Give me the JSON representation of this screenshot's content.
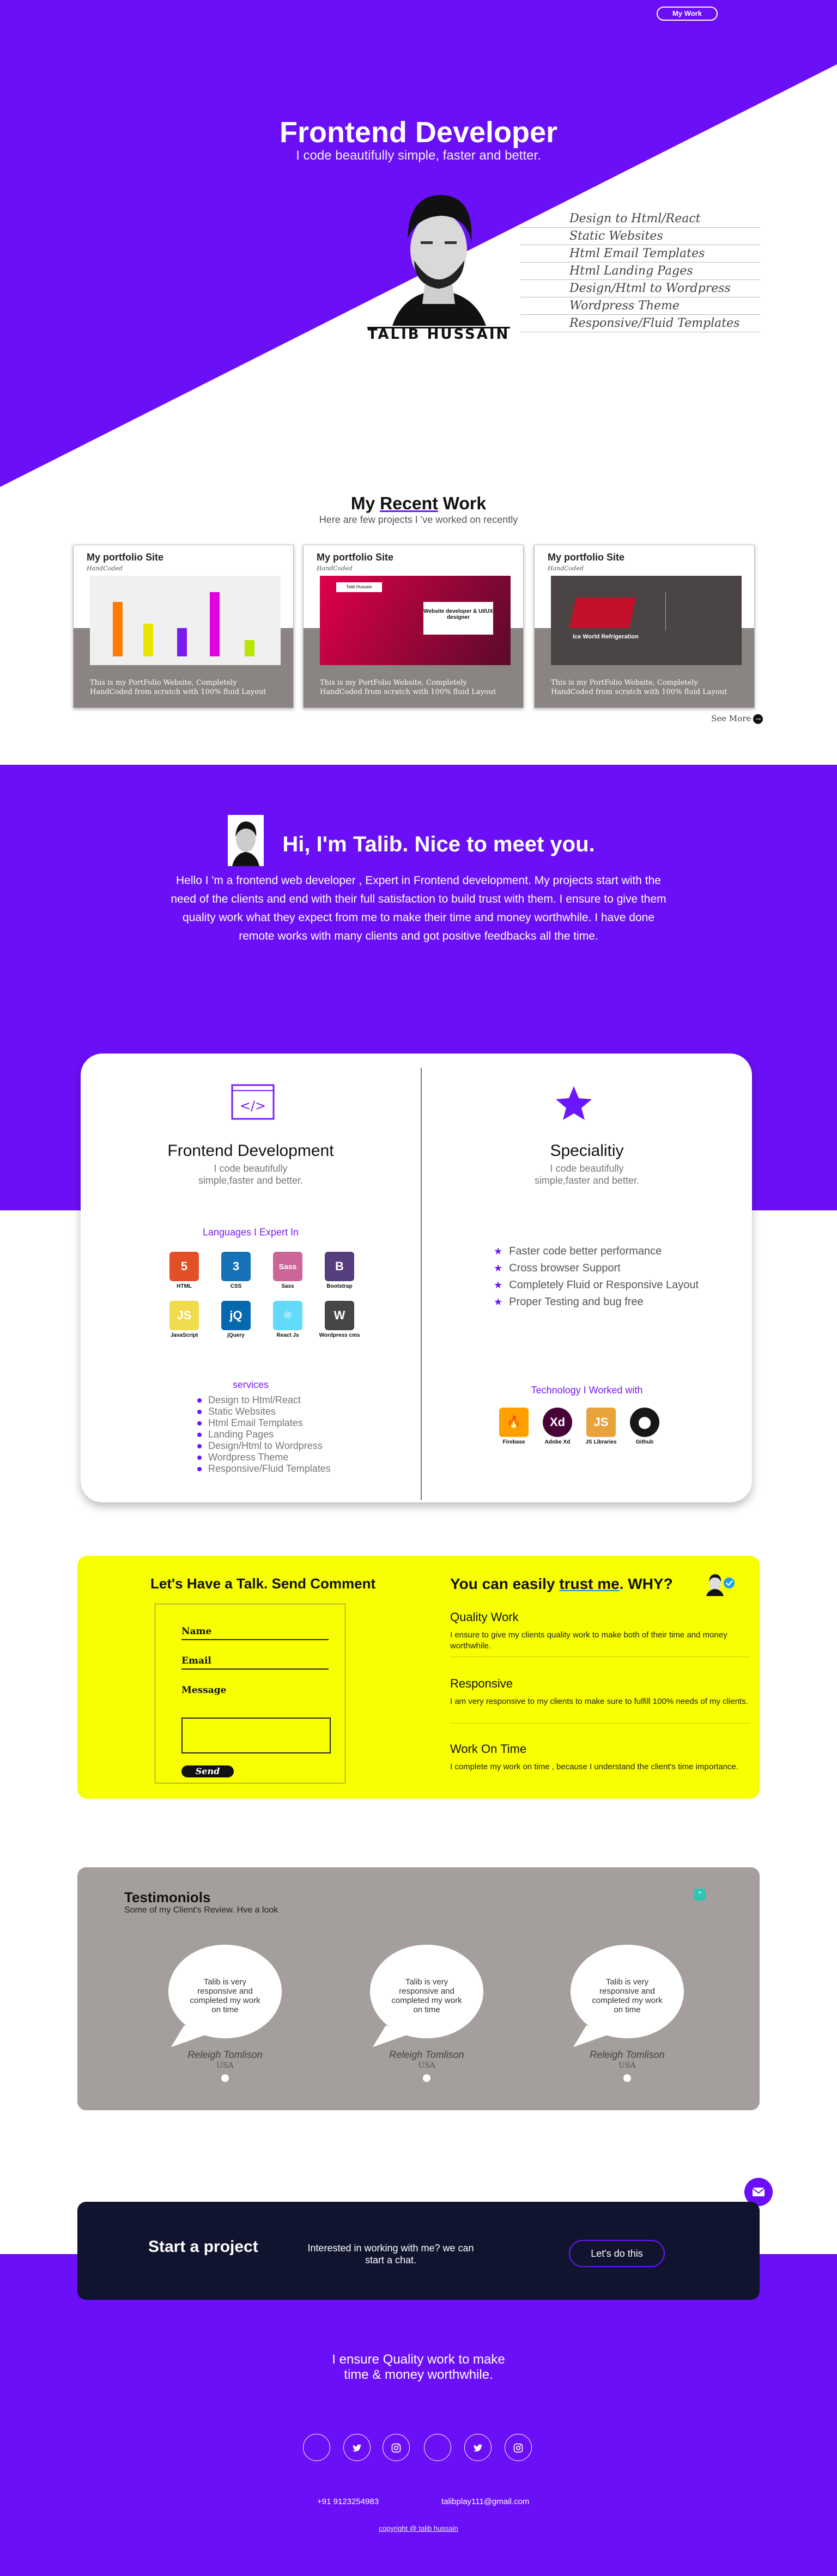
{
  "nav": {
    "my_work": "My Work"
  },
  "hero": {
    "title": "Frontend Developer",
    "subtitle": "I code beautifully simple, faster and better.",
    "name_caption": "TALIB HUSSAIN",
    "skills": [
      "Design to Html/React",
      "Static Websites",
      "Html Email Templates",
      "Html Landing Pages",
      "Design/Html to Wordpress",
      "Wordpress Theme",
      "Responsive/Fluid Templates"
    ]
  },
  "recent": {
    "title_pre": "My ",
    "title_u": "Recent",
    "title_post": " Work",
    "subtitle": "Here are few projects I 've worked on recently",
    "cards": [
      {
        "title": "My portfolio Site",
        "subtitle": "HandCoded",
        "desc": "This is my PortFolio Website, Completely HandCoded from scratch with 100% fluid Layout"
      },
      {
        "title": "My portfolio Site",
        "subtitle": "HandCoded",
        "desc": "This is my PortFolio Website, Completely HandCoded from scratch with 100% fluid Layout",
        "shot_text_a": "Talib Hussain",
        "shot_text_b": "Website developer & UI/UX designer"
      },
      {
        "title": "My portfolio Site",
        "subtitle": "HandCoded",
        "desc": "This is my PortFolio Website, Completely HandCoded from scratch with 100% fluid Layout",
        "shot_text_a": "Ice World Refrigeration"
      }
    ],
    "see_more": "See More"
  },
  "about": {
    "title": "Hi, I'm Talib. Nice to meet you.",
    "text": "Hello I 'm a frontend web developer , Expert in Frontend development. My projects start with the need of the clients and end with their full satisfaction to build trust with them. I ensure to give them quality work what they expect from me to make their time and money worthwhile. I have done remote works with many clients and got positive feedbacks all the time."
  },
  "services": {
    "left": {
      "title": "Frontend Development",
      "subtitle": "I code beautifully simple,faster and better.",
      "languages_title": "Languages I Expert In",
      "languages": [
        {
          "label": "HTML",
          "glyph": "5",
          "color": "#e34f26"
        },
        {
          "label": "CSS",
          "glyph": "3",
          "color": "#1572b6"
        },
        {
          "label": "Sass",
          "glyph": "Sass",
          "color": "#cc6699"
        },
        {
          "label": "Bootstrap",
          "glyph": "B",
          "color": "#563d7c"
        },
        {
          "label": "JavaScript",
          "glyph": "JS",
          "color": "#f0db4f"
        },
        {
          "label": "jQuery",
          "glyph": "jQ",
          "color": "#0769ad"
        },
        {
          "label": "React Js",
          "glyph": "⚛",
          "color": "#61dafb"
        },
        {
          "label": "Wordpress cms",
          "glyph": "W",
          "color": "#464646"
        }
      ],
      "services_title": "services",
      "services": [
        "Design to Html/React",
        "Static Websites",
        "Html Email Templates",
        "Landing Pages",
        "Design/Html to Wordpress",
        "Wordpress Theme",
        "Responsive/Fluid Templates"
      ]
    },
    "right": {
      "title": "Specialitiy",
      "subtitle": "I code beautifully simple,faster and better.",
      "items": [
        "Faster code better performance",
        "Cross browser Support",
        "Completely Fluid or Responsive Layout",
        "Proper Testing and bug free"
      ],
      "tech_title": "Technology I Worked with",
      "tech": [
        {
          "label": "Firebase",
          "glyph": "🔥",
          "color": "#ffa000"
        },
        {
          "label": "Adobe Xd",
          "glyph": "Xd",
          "color": "#470137"
        },
        {
          "label": "JS Libraries",
          "glyph": "JS",
          "color": "#e8a33d"
        },
        {
          "label": "Github",
          "glyph": "⬤",
          "color": "#181717"
        }
      ]
    }
  },
  "contact": {
    "title": "Let's Have a Talk. Send Comment",
    "name_label": "Name",
    "email_label": "Email",
    "message_label": "Message",
    "send": "Send",
    "why_pre": "You can easily ",
    "why_u": "trust me",
    "why_post": ". WHY?",
    "reasons": [
      {
        "title": "Quality Work",
        "text": "I ensure to give my clients quality work to make both of their time and money worthwhile."
      },
      {
        "title": "Responsive",
        "text": "I am very responsive to my clients to make sure to fulfill 100% needs of my clients."
      },
      {
        "title": "Work On Time",
        "text": "I complete my work on time , because I understand the client's time importance."
      }
    ]
  },
  "testimonials": {
    "title": "Testimoniols",
    "subtitle": "Some of my Client's Review. Hve a look",
    "items": [
      {
        "text": "Talib is very responsive and completed my work on time",
        "name": "Releigh Tomlison",
        "location": "USA"
      },
      {
        "text": "Talib is very responsive and completed my work on time",
        "name": "Releigh Tomlison",
        "location": "USA"
      },
      {
        "text": "Talib is very responsive and completed my work on time",
        "name": "Releigh Tomlison",
        "location": "USA"
      }
    ]
  },
  "project": {
    "title": "Start a project",
    "text": "Interested in working with me? we can start a chat.",
    "button": "Let's do this"
  },
  "footer": {
    "tagline": "I ensure Quality work to make time & money worthwhile.",
    "phone": "+91 9123254983",
    "email": "talibplay111@gmail.com",
    "copy": "copyright @ talib hussain"
  },
  "colors": {
    "brand": "#6b0ff6",
    "yellow": "#f8ff00",
    "dark": "#11142e",
    "gray": "#a49e9c"
  }
}
